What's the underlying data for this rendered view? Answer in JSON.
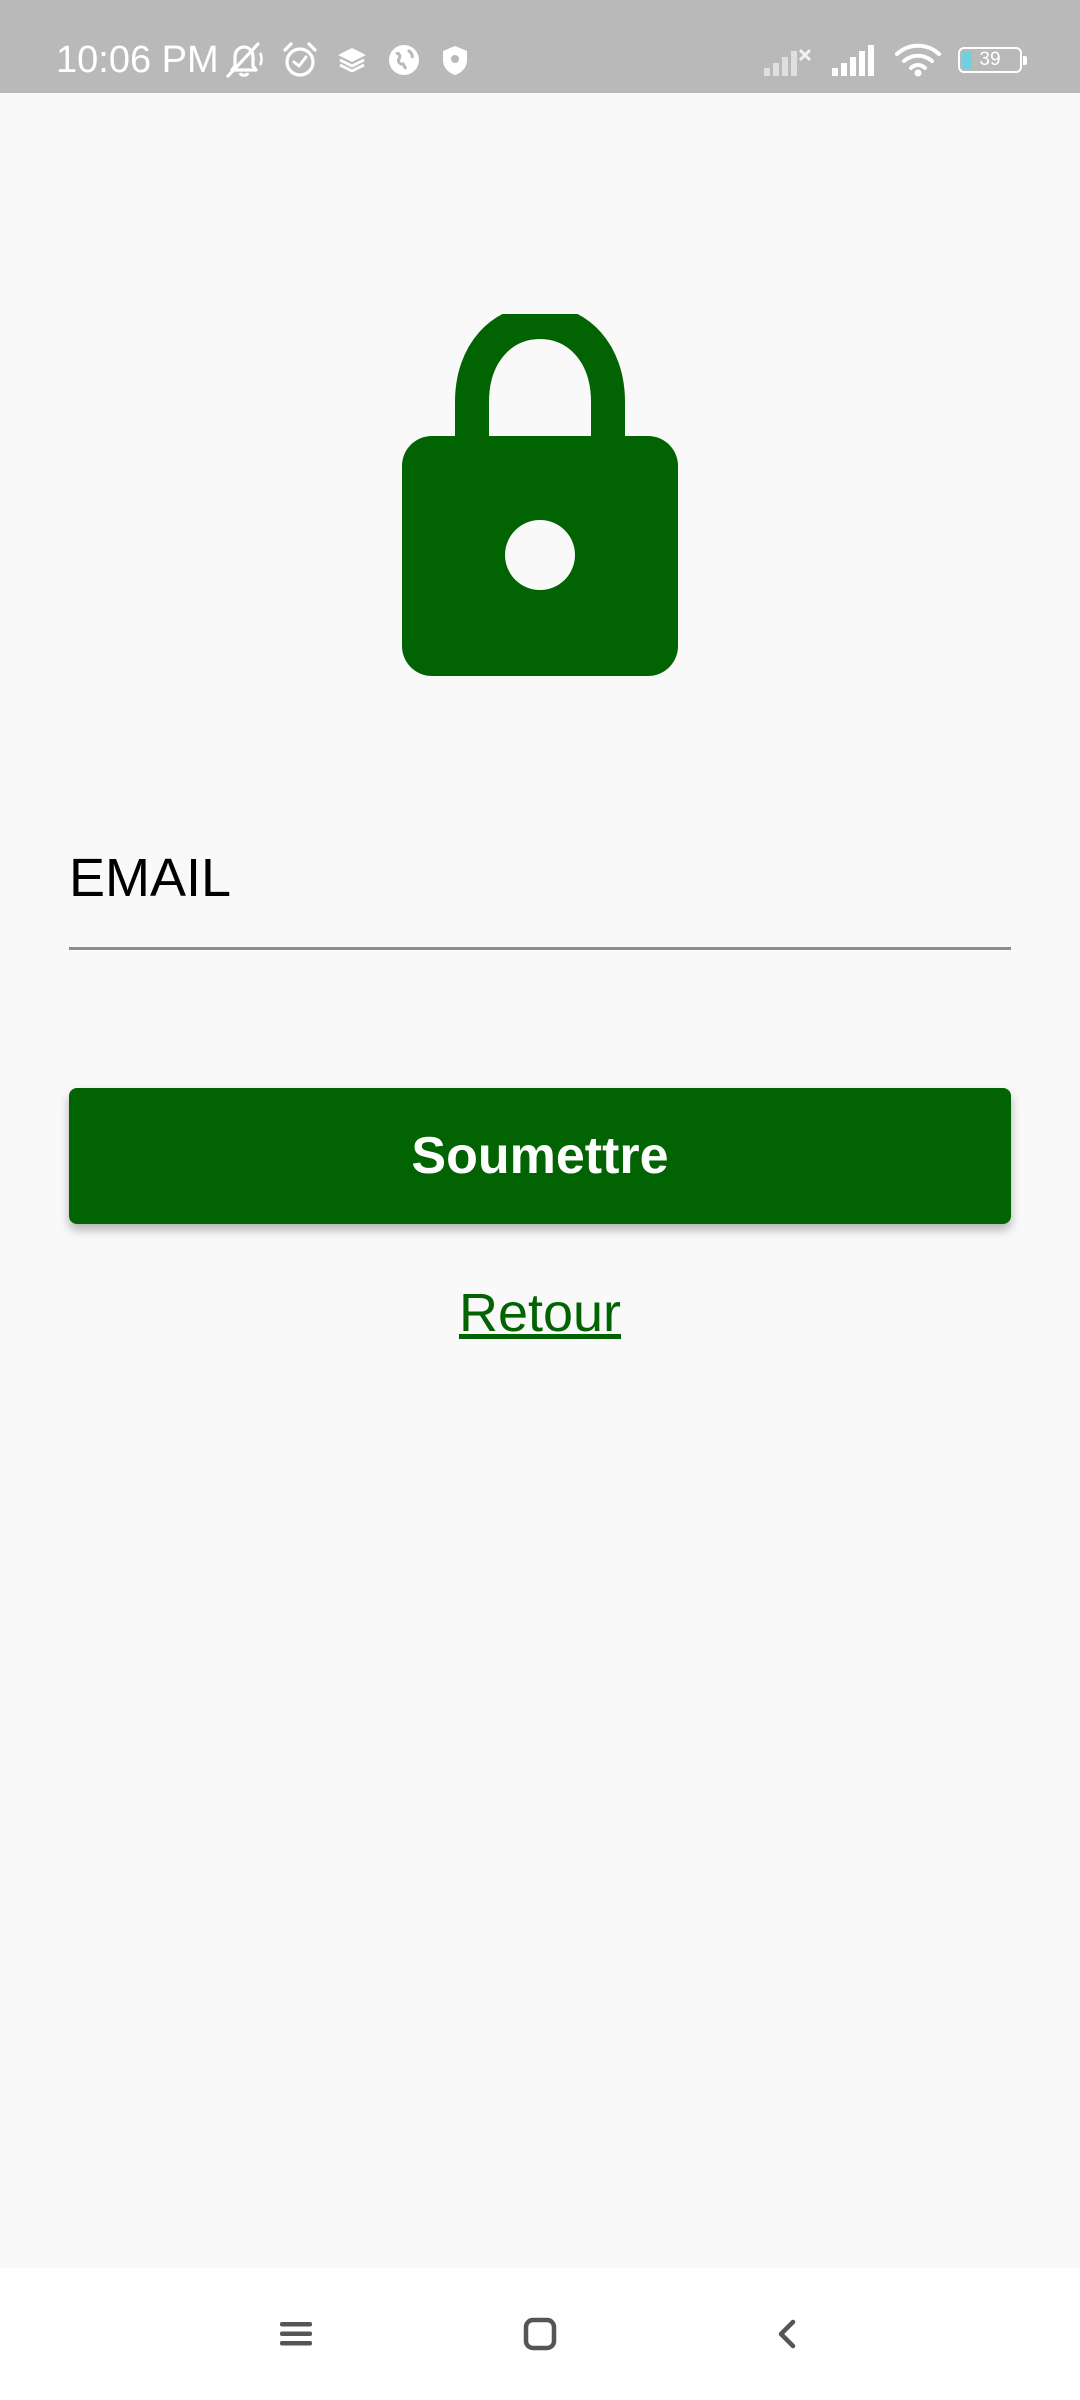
{
  "status_bar": {
    "time": "10:06 PM",
    "battery_level": "39",
    "left_icons": [
      "mute-bell-icon",
      "alarm-icon",
      "layers-icon",
      "vpn-globe-icon",
      "shield-icon"
    ],
    "right_icons": [
      "no-signal-icon",
      "signal-icon",
      "wifi-icon",
      "battery-icon"
    ]
  },
  "main": {
    "lock_icon": "lock-icon",
    "email_placeholder": "EMAIL",
    "email_value": "",
    "submit_label": "Soumettre",
    "back_link_label": "Retour"
  },
  "nav_bar": {
    "buttons": [
      "menu-icon",
      "home-icon",
      "back-icon"
    ]
  },
  "colors": {
    "accent": "#016301",
    "background": "#f9f9f9",
    "status_bar": "#b9b9b9",
    "input_underline": "#8d8d8d"
  }
}
